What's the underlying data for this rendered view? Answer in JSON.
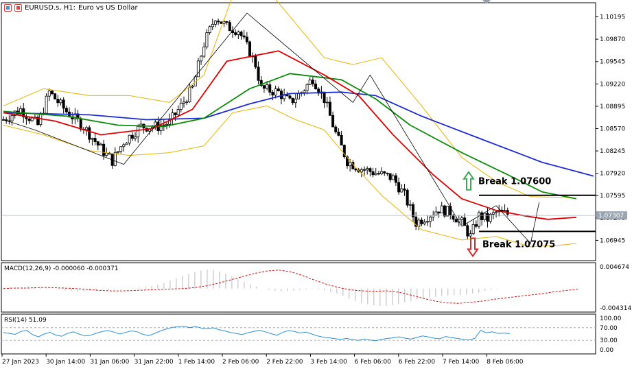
{
  "header": {
    "symbol": "EURUSD.s, H1:",
    "description": "Euro vs US Dollar",
    "icons": [
      "chart-window-icon",
      "chart-window-icon"
    ]
  },
  "colors": {
    "bg": "#ffffff",
    "frame": "#000000",
    "grid_axis": "#808080",
    "ma_fast": "#e00000",
    "ma_mid": "#0a8c0a",
    "ma_slow": "#1a2bd1",
    "bands": "#e6b400",
    "macd_hist": "#b8b8b8",
    "macd_signal": "#d01010",
    "rsi_line": "#2b8fd6",
    "break_up_arrow": "#3daa55",
    "break_down_arrow": "#d72a2a",
    "price_tag_bg": "#9aa5b1"
  },
  "chart_data": {
    "type": "candlestick",
    "price_axis": {
      "labels": [
        "1.10195",
        "1.09870",
        "1.09545",
        "1.09220",
        "1.08895",
        "1.08570",
        "1.08245",
        "1.07920",
        "1.07595",
        "1.07270",
        "1.06945"
      ],
      "min": 1.0665,
      "max": 1.104
    },
    "current_price": "1.07307",
    "time_axis": {
      "labels": [
        "27 Jan 2023",
        "30 Jan 14:00",
        "31 Jan 06:00",
        "31 Jan 22:00",
        "1 Feb 14:00",
        "2 Feb 06:00",
        "2 Feb 22:00",
        "3 Feb 14:00",
        "6 Feb 06:00",
        "6 Feb 22:00",
        "7 Feb 14:00",
        "8 Feb 06:00"
      ]
    },
    "close_path": [
      [
        0,
        1.087
      ],
      [
        6,
        1.0885
      ],
      [
        12,
        1.0862
      ],
      [
        16,
        1.091
      ],
      [
        22,
        1.0882
      ],
      [
        28,
        1.086
      ],
      [
        34,
        1.0828
      ],
      [
        38,
        1.081
      ],
      [
        42,
        1.0838
      ],
      [
        48,
        1.086
      ],
      [
        54,
        1.086
      ],
      [
        58,
        1.0866
      ],
      [
        62,
        1.089
      ],
      [
        66,
        1.0916
      ],
      [
        70,
        1.098
      ],
      [
        74,
        1.102
      ],
      [
        78,
        1.1005
      ],
      [
        82,
        1.1
      ],
      [
        86,
        1.0968
      ],
      [
        88,
        1.095
      ],
      [
        90,
        1.0915
      ],
      [
        96,
        1.091
      ],
      [
        100,
        1.0895
      ],
      [
        104,
        1.091
      ],
      [
        108,
        1.093
      ],
      [
        112,
        1.09
      ],
      [
        116,
        1.085
      ],
      [
        120,
        1.081
      ],
      [
        124,
        1.08
      ],
      [
        128,
        1.0795
      ],
      [
        132,
        1.079
      ],
      [
        136,
        1.0785
      ],
      [
        140,
        1.076
      ],
      [
        144,
        1.072
      ],
      [
        148,
        1.073
      ],
      [
        152,
        1.074
      ],
      [
        156,
        1.0735
      ],
      [
        160,
        1.072
      ],
      [
        163,
        1.07
      ],
      [
        166,
        1.073
      ],
      [
        169,
        1.0725
      ],
      [
        172,
        1.0735
      ],
      [
        176,
        1.0733
      ]
    ],
    "zigzag": [
      [
        0,
        1.087
      ],
      [
        11,
        1.0855
      ],
      [
        42,
        1.0805
      ],
      [
        85,
        1.1025
      ],
      [
        122,
        1.0895
      ],
      [
        128,
        1.0935
      ],
      [
        160,
        1.0715
      ],
      [
        172,
        1.0745
      ],
      [
        184,
        1.069
      ],
      [
        187,
        1.075
      ]
    ],
    "ma_fast": [
      [
        0,
        1.088
      ],
      [
        18,
        1.0868
      ],
      [
        34,
        1.0848
      ],
      [
        52,
        1.0857
      ],
      [
        66,
        1.0885
      ],
      [
        78,
        1.0955
      ],
      [
        96,
        1.097
      ],
      [
        112,
        1.0935
      ],
      [
        124,
        1.0905
      ],
      [
        136,
        1.0848
      ],
      [
        150,
        1.079
      ],
      [
        160,
        1.0755
      ],
      [
        172,
        1.0738
      ],
      [
        182,
        1.073
      ],
      [
        190,
        1.0725
      ],
      [
        200,
        1.0728
      ]
    ],
    "ma_mid": [
      [
        0,
        1.0882
      ],
      [
        22,
        1.0875
      ],
      [
        40,
        1.0862
      ],
      [
        56,
        1.086
      ],
      [
        70,
        1.0872
      ],
      [
        86,
        1.0915
      ],
      [
        100,
        1.0937
      ],
      [
        118,
        1.0928
      ],
      [
        130,
        1.09
      ],
      [
        142,
        1.0862
      ],
      [
        160,
        1.0822
      ],
      [
        176,
        1.079
      ],
      [
        188,
        1.0765
      ],
      [
        200,
        1.0755
      ]
    ],
    "ma_slow": [
      [
        0,
        1.088
      ],
      [
        30,
        1.0877
      ],
      [
        50,
        1.087
      ],
      [
        70,
        1.0872
      ],
      [
        86,
        1.0893
      ],
      [
        100,
        1.0908
      ],
      [
        118,
        1.091
      ],
      [
        130,
        1.0905
      ],
      [
        146,
        1.0875
      ],
      [
        166,
        1.0843
      ],
      [
        188,
        1.0808
      ],
      [
        206,
        1.0788
      ]
    ],
    "bands_upper": [
      [
        0,
        1.089
      ],
      [
        14,
        1.0915
      ],
      [
        30,
        1.0905
      ],
      [
        44,
        1.0905
      ],
      [
        58,
        1.0895
      ],
      [
        70,
        1.0935
      ],
      [
        80,
        1.105
      ],
      [
        92,
        1.106
      ],
      [
        102,
        1.101
      ],
      [
        112,
        1.096
      ],
      [
        122,
        1.095
      ],
      [
        132,
        1.096
      ],
      [
        146,
        1.089
      ],
      [
        160,
        1.0815
      ],
      [
        172,
        1.078
      ],
      [
        184,
        1.0758
      ],
      [
        196,
        1.0757
      ],
      [
        200,
        1.0755
      ]
    ],
    "bands_lower": [
      [
        0,
        1.0862
      ],
      [
        14,
        1.0848
      ],
      [
        30,
        1.0825
      ],
      [
        44,
        1.0818
      ],
      [
        58,
        1.0822
      ],
      [
        70,
        1.0832
      ],
      [
        80,
        1.088
      ],
      [
        92,
        1.089
      ],
      [
        102,
        1.087
      ],
      [
        112,
        1.0855
      ],
      [
        122,
        1.0805
      ],
      [
        132,
        1.076
      ],
      [
        146,
        1.071
      ],
      [
        160,
        1.0695
      ],
      [
        172,
        1.07
      ],
      [
        184,
        1.0685
      ],
      [
        196,
        1.0688
      ],
      [
        200,
        1.069
      ]
    ],
    "levels": [
      {
        "price": 1.076,
        "label": "Break 1.07600",
        "direction": "up"
      },
      {
        "price": 1.07075,
        "label": "Break 1.07075",
        "direction": "down"
      }
    ],
    "macd": {
      "label": "MACD(12,26,9) -0.000060 -0.000371",
      "axis_labels": [
        "0.004674",
        "-0.004314"
      ],
      "min": -0.0045,
      "max": 0.005,
      "histogram": [
        0.0002,
        0.0002,
        0.0001,
        0.0003,
        0.0005,
        0.0004,
        0.0002,
        0.0001,
        0.0001,
        -0.0002,
        -0.0004,
        -0.0006,
        -0.0007,
        -0.0006,
        -0.0005,
        -0.0004,
        -0.0003,
        -0.0003,
        -0.0002,
        -0.0001,
        0.0,
        0.0001,
        0.0002,
        0.0003,
        0.0005,
        0.0008,
        0.0012,
        0.0017,
        0.0022,
        0.0027,
        0.0032,
        0.0036,
        0.0039,
        0.0041,
        0.004,
        0.0037,
        0.0032,
        0.0026,
        0.002,
        0.0014,
        0.0009,
        0.0004,
        0.0,
        -0.0003,
        -0.0005,
        -0.0006,
        -0.0005,
        -0.0004,
        -0.0003,
        -0.0002,
        -0.0001,
        -0.0002,
        -0.0004,
        -0.0007,
        -0.0011,
        -0.0016,
        -0.0022,
        -0.0027,
        -0.0031,
        -0.0034,
        -0.0036,
        -0.0038,
        -0.0038,
        -0.0036,
        -0.0033,
        -0.003,
        -0.0027,
        -0.0024,
        -0.0022,
        -0.002,
        -0.0018,
        -0.0016,
        -0.0015,
        -0.0014,
        -0.0014,
        -0.0013,
        -0.0011,
        -0.0009,
        -0.0005,
        -0.0003,
        -0.0001,
        0.0
      ],
      "signal": [
        0.0,
        0.0001,
        0.0001,
        0.0002,
        0.0002,
        0.0001,
        0.0,
        -0.0002,
        -0.0004,
        -0.0005,
        -0.0005,
        -0.0004,
        -0.0003,
        -0.0002,
        -0.0001,
        0.0,
        0.0002,
        0.0006,
        0.0012,
        0.0019,
        0.0026,
        0.0033,
        0.0038,
        0.004,
        0.0036,
        0.0028,
        0.0018,
        0.0009,
        0.0002,
        -0.0003,
        -0.0005,
        -0.0006,
        -0.0005,
        -0.0008,
        -0.0014,
        -0.0021,
        -0.0027,
        -0.0031,
        -0.0032,
        -0.003,
        -0.0027,
        -0.0023,
        -0.002,
        -0.0017,
        -0.0014,
        -0.0011,
        -0.0007,
        -0.0004,
        -0.0001
      ]
    },
    "rsi": {
      "label": "RSI(14) 51.09",
      "axis_labels": [
        "100.00",
        "70.00",
        "30.00",
        "0.00"
      ],
      "levels": [
        70,
        30
      ],
      "values": [
        55,
        52,
        49,
        58,
        62,
        48,
        41,
        50,
        55,
        47,
        43,
        52,
        57,
        50,
        44,
        46,
        53,
        58,
        61,
        56,
        50,
        55,
        60,
        57,
        49,
        45,
        52,
        60,
        66,
        71,
        73,
        75,
        70,
        74,
        69,
        66,
        70,
        64,
        60,
        55,
        52,
        48,
        54,
        58,
        62,
        57,
        51,
        46,
        55,
        61,
        58,
        53,
        56,
        50,
        44,
        40,
        38,
        35,
        33,
        36,
        32,
        30,
        34,
        31,
        29,
        33,
        36,
        38,
        41,
        37,
        34,
        39,
        44,
        41,
        37,
        35,
        42,
        39,
        36,
        33,
        31,
        36,
        62,
        54,
        57,
        52,
        53,
        51
      ]
    }
  }
}
